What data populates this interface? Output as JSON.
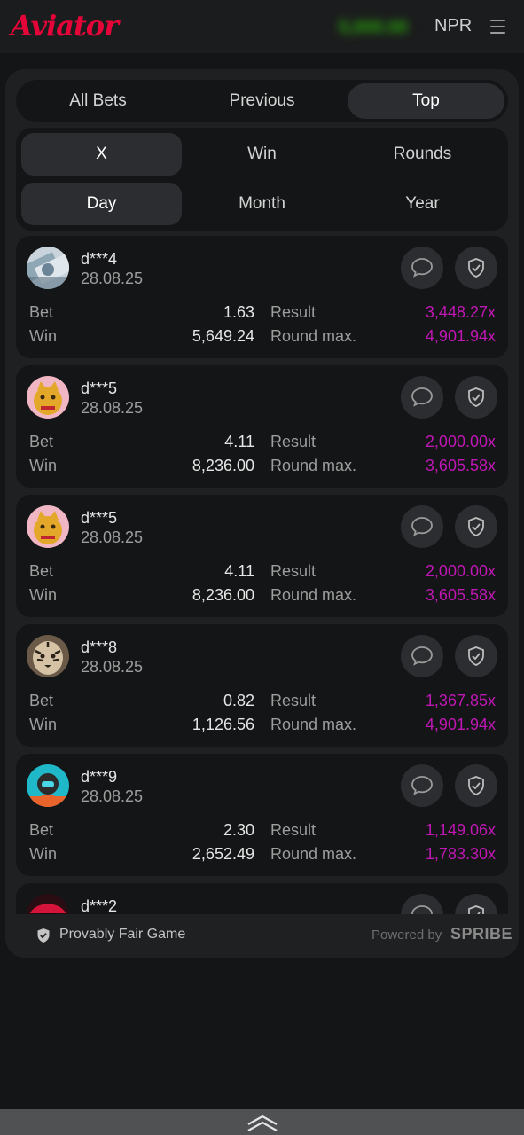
{
  "header": {
    "logo": "Aviator",
    "balance": "5,000.00",
    "currency": "NPR"
  },
  "tabs": [
    {
      "label": "All Bets",
      "active": false
    },
    {
      "label": "Previous",
      "active": false
    },
    {
      "label": "Top",
      "active": true
    }
  ],
  "filters": {
    "row1": [
      {
        "label": "X",
        "active": true
      },
      {
        "label": "Win",
        "active": false
      },
      {
        "label": "Rounds",
        "active": false
      }
    ],
    "row2": [
      {
        "label": "Day",
        "active": true
      },
      {
        "label": "Month",
        "active": false
      },
      {
        "label": "Year",
        "active": false
      }
    ]
  },
  "labels": {
    "bet": "Bet",
    "win": "Win",
    "result": "Result",
    "round_max": "Round max."
  },
  "bets": [
    {
      "user": "d***4",
      "date": "28.08.25",
      "bet": "1.63",
      "win": "5,649.24",
      "result": "3,448.27x",
      "round_max": "4,901.94x",
      "avatar": "banknote"
    },
    {
      "user": "d***5",
      "date": "28.08.25",
      "bet": "4.11",
      "win": "8,236.00",
      "result": "2,000.00x",
      "round_max": "3,605.58x",
      "avatar": "lucky-cat"
    },
    {
      "user": "d***5",
      "date": "28.08.25",
      "bet": "4.11",
      "win": "8,236.00",
      "result": "2,000.00x",
      "round_max": "3,605.58x",
      "avatar": "lucky-cat"
    },
    {
      "user": "d***8",
      "date": "28.08.25",
      "bet": "0.82",
      "win": "1,126.56",
      "result": "1,367.85x",
      "round_max": "4,901.94x",
      "avatar": "tiger"
    },
    {
      "user": "d***9",
      "date": "28.08.25",
      "bet": "2.30",
      "win": "2,652.49",
      "result": "1,149.06x",
      "round_max": "1,783.30x",
      "avatar": "masked-person"
    },
    {
      "user": "d***2",
      "date": "",
      "bet": "",
      "win": "",
      "result": "",
      "round_max": "",
      "avatar": "red-hat"
    }
  ],
  "footer": {
    "fair_text": "Provably Fair Game",
    "powered_by": "Powered by",
    "brand": "SPRIBE"
  },
  "colors": {
    "brand_red": "#e50539",
    "multiplier": "#c017b4",
    "balance_green": "#28a909"
  }
}
